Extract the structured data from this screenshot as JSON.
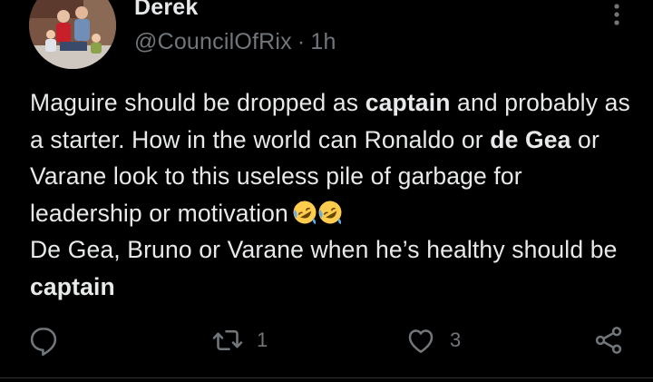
{
  "tweet": {
    "author": {
      "display_name": "Derek",
      "handle": "@CouncilOfRix",
      "separator": "·",
      "timestamp": "1h"
    },
    "body": {
      "p1": "Maguire should be dropped as ",
      "b1": "captain",
      "p2": " and probably as a starter. How in the world can Ronaldo or ",
      "b2": "de Gea",
      "p3": " or Varane look to this useless pile of garbage for leadership or motivation",
      "emoji_1": "rolling-on-the-floor-laughing",
      "emoji_2": "rolling-on-the-floor-laughing",
      "p4": "De Gea, Bruno or Varane when he’s healthy should be ",
      "b3": "captain"
    },
    "actions": {
      "reply_icon": "reply-icon",
      "retweet_icon": "retweet-icon",
      "retweet_count": "1",
      "like_icon": "heart-icon",
      "like_count": "3",
      "share_icon": "share-icon"
    },
    "colors": {
      "background": "#000000",
      "text": "#e7e9ea",
      "secondary": "#71767b"
    }
  }
}
